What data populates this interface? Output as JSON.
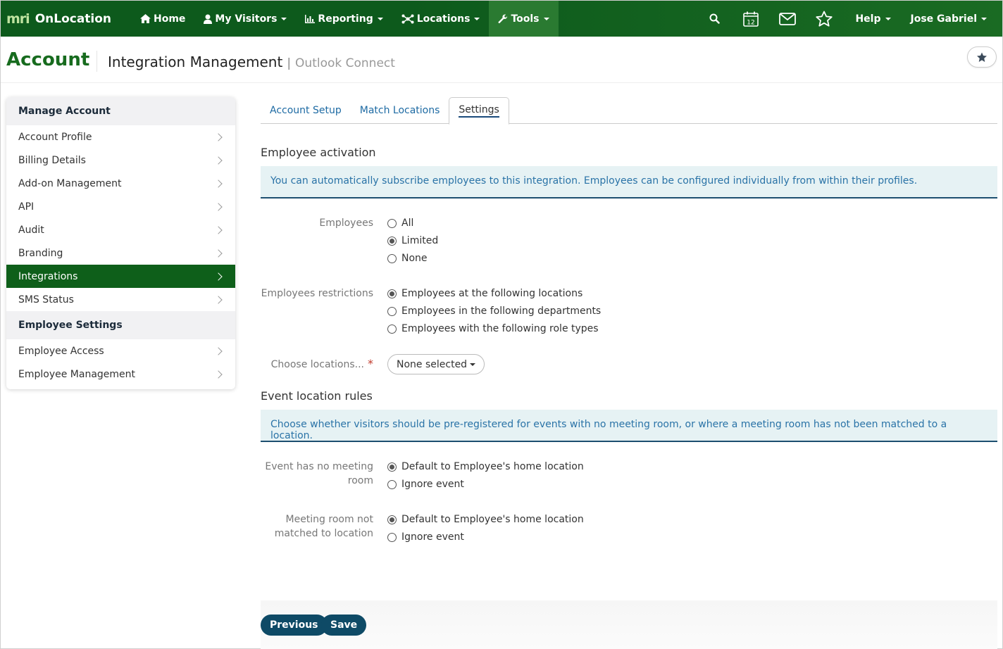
{
  "nav": {
    "logo_text": "mri",
    "brand": "OnLocation",
    "items": [
      {
        "label": "Home",
        "icon": "home-icon",
        "caret": false
      },
      {
        "label": "My Visitors",
        "icon": "user-icon",
        "caret": true
      },
      {
        "label": "Reporting",
        "icon": "bar-chart-icon",
        "caret": true
      },
      {
        "label": "Locations",
        "icon": "network-icon",
        "caret": true
      },
      {
        "label": "Tools",
        "icon": "wrench-icon",
        "caret": true
      }
    ],
    "calendar_day": "12",
    "help_label": "Help",
    "user_label": "Jose Gabriel",
    "colors": {
      "bar": "#0d5a1c",
      "active": "#2a7a31"
    }
  },
  "header": {
    "title": "Account",
    "subtitle": "Integration Management",
    "sub2": "Outlook Connect",
    "separator": "|"
  },
  "sidebar": {
    "sections": [
      {
        "heading": "Manage Account",
        "items": [
          {
            "label": "Account Profile",
            "active": false
          },
          {
            "label": "Billing Details",
            "active": false
          },
          {
            "label": "Add-on Management",
            "active": false
          },
          {
            "label": "API",
            "active": false
          },
          {
            "label": "Audit",
            "active": false
          },
          {
            "label": "Branding",
            "active": false
          },
          {
            "label": "Integrations",
            "active": true
          },
          {
            "label": "SMS Status",
            "active": false
          }
        ]
      },
      {
        "heading": "Employee Settings",
        "items": [
          {
            "label": "Employee Access",
            "active": false
          },
          {
            "label": "Employee Management",
            "active": false
          }
        ]
      }
    ]
  },
  "tabs": [
    {
      "label": "Account Setup",
      "active": false
    },
    {
      "label": "Match Locations",
      "active": false
    },
    {
      "label": "Settings",
      "active": true
    }
  ],
  "employee_activation": {
    "title": "Employee activation",
    "info": "You can automatically subscribe employees to this integration. Employees can be configured individually from within their profiles.",
    "employees": {
      "label": "Employees",
      "options": [
        "All",
        "Limited",
        "None"
      ],
      "selected": "Limited"
    },
    "restrictions": {
      "label": "Employees restrictions",
      "options": [
        "Employees at the following locations",
        "Employees in the following departments",
        "Employees with the following role types"
      ],
      "selected": "Employees at the following locations"
    },
    "choose_locations": {
      "label": "Choose locations...",
      "required_mark": "*",
      "value": "None selected"
    }
  },
  "event_rules": {
    "title": "Event location rules",
    "info": "Choose whether visitors should be pre-registered for events with no meeting room, or where a meeting room has not been matched to a location.",
    "no_room": {
      "label_line1": "Event has no meeting",
      "label_line2": "room",
      "options": [
        "Default to Employee's home location",
        "Ignore event"
      ],
      "selected": "Default to Employee's home location"
    },
    "not_matched": {
      "label_line1": "Meeting room not",
      "label_line2": "matched to location",
      "options": [
        "Default to Employee's home location",
        "Ignore event"
      ],
      "selected": "Default to Employee's home location"
    }
  },
  "buttons": {
    "previous": "Previous",
    "save": "Save",
    "color": "#0e4a66"
  }
}
